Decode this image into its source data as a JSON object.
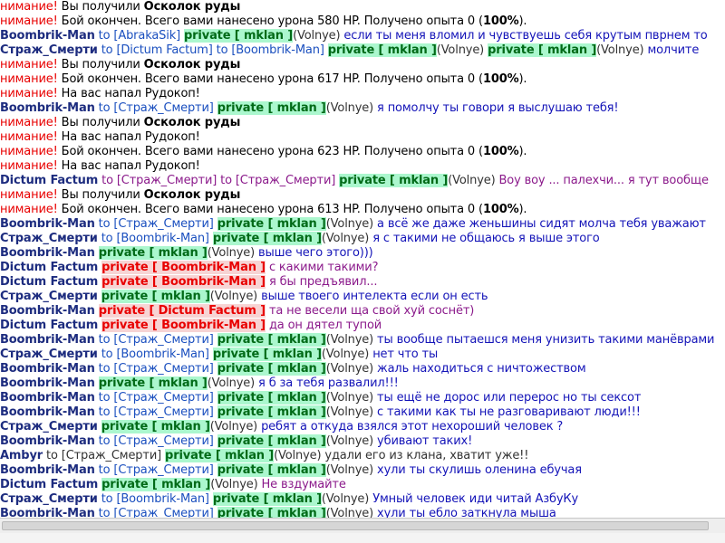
{
  "colors": {
    "attention": "#e80000",
    "system": "#000000",
    "name_dark": "#1d2c7f",
    "name_green": "#008000",
    "private_green_bg": "#abf7ce",
    "private_green_fg": "#006a17",
    "private_red_bg": "#f7d4d4",
    "private_red_fg": "#e80000",
    "to_target": "#1a4fbf"
  },
  "messages": [
    {
      "kind": "sys",
      "parts": [
        {
          "t": "нимание! ",
          "c": "#e80000"
        },
        {
          "t": "Вы получили ",
          "c": "#000000"
        },
        {
          "t": "Осколок руды",
          "c": "#000000",
          "b": true
        }
      ]
    },
    {
      "kind": "sys",
      "parts": [
        {
          "t": "нимание! ",
          "c": "#e80000"
        },
        {
          "t": "Бой окончен. Всего вами нанесено урона 580 HP. Получено опыта 0 (",
          "c": "#000000"
        },
        {
          "t": "100%",
          "c": "#000000",
          "b": true
        },
        {
          "t": ").",
          "c": "#000000"
        }
      ]
    },
    {
      "kind": "chat",
      "parts": [
        {
          "t": "Boombrik-Man",
          "c": "#1d2c7f",
          "b": true
        },
        {
          "t": " to [AbrakaSik] ",
          "c": "#1a4fbf"
        },
        {
          "t": "private [ mklan ]",
          "p": "g"
        },
        {
          "t": "(Volnye) ",
          "c": "#333333"
        },
        {
          "t": "если ты меня вломил и чувствуешь себя крутым пврнем то",
          "c": "#1414b8"
        }
      ]
    },
    {
      "kind": "chat",
      "parts": [
        {
          "t": "Страж_Смерти",
          "c": "#1d2c7f",
          "b": true
        },
        {
          "t": " to [Dictum Factum] to [Boombrik-Man] ",
          "c": "#1a4fbf"
        },
        {
          "t": "private [ mklan ]",
          "p": "g"
        },
        {
          "t": "(Volnye) ",
          "c": "#333333"
        },
        {
          "t": "private [ mklan ]",
          "p": "g"
        },
        {
          "t": "(Volnye) ",
          "c": "#333333"
        },
        {
          "t": "молчите",
          "c": "#1414b8"
        }
      ]
    },
    {
      "kind": "sys",
      "parts": [
        {
          "t": "нимание! ",
          "c": "#e80000"
        },
        {
          "t": "Вы получили ",
          "c": "#000000"
        },
        {
          "t": "Осколок руды",
          "c": "#000000",
          "b": true
        }
      ]
    },
    {
      "kind": "sys",
      "parts": [
        {
          "t": "нимание! ",
          "c": "#e80000"
        },
        {
          "t": "Бой окончен. Всего вами нанесено урона 617 HP. Получено опыта 0 (",
          "c": "#000000"
        },
        {
          "t": "100%",
          "c": "#000000",
          "b": true
        },
        {
          "t": ").",
          "c": "#000000"
        }
      ]
    },
    {
      "kind": "sys",
      "parts": [
        {
          "t": "нимание! ",
          "c": "#e80000"
        },
        {
          "t": "На вас напал Рудокоп!",
          "c": "#000000"
        }
      ]
    },
    {
      "kind": "chat",
      "parts": [
        {
          "t": "Boombrik-Man",
          "c": "#1d2c7f",
          "b": true
        },
        {
          "t": " to [Страж_Смерти] ",
          "c": "#1a4fbf"
        },
        {
          "t": "private [ mklan ]",
          "p": "g"
        },
        {
          "t": "(Volnye) ",
          "c": "#333333"
        },
        {
          "t": "я помолчу ты говори я выслушаю тебя!",
          "c": "#1414b8"
        }
      ]
    },
    {
      "kind": "sys",
      "parts": [
        {
          "t": "нимание! ",
          "c": "#e80000"
        },
        {
          "t": "Вы получили ",
          "c": "#000000"
        },
        {
          "t": "Осколок руды",
          "c": "#000000",
          "b": true
        }
      ]
    },
    {
      "kind": "sys",
      "parts": [
        {
          "t": "нимание! ",
          "c": "#e80000"
        },
        {
          "t": "На вас напал Рудокоп!",
          "c": "#000000"
        }
      ]
    },
    {
      "kind": "sys",
      "parts": [
        {
          "t": "нимание! ",
          "c": "#e80000"
        },
        {
          "t": "Бой окончен. Всего вами нанесено урона 623 HP. Получено опыта 0 (",
          "c": "#000000"
        },
        {
          "t": "100%",
          "c": "#000000",
          "b": true
        },
        {
          "t": ").",
          "c": "#000000"
        }
      ]
    },
    {
      "kind": "sys",
      "parts": [
        {
          "t": "нимание! ",
          "c": "#e80000"
        },
        {
          "t": "На вас напал Рудокоп!",
          "c": "#000000"
        }
      ]
    },
    {
      "kind": "chat",
      "parts": [
        {
          "t": "Dictum Factum",
          "c": "#1d2c7f",
          "b": true
        },
        {
          "t": " to [Страж_Смерти] to [Страж_Смерти] ",
          "c": "#8b1a8b"
        },
        {
          "t": "private [ mklan ]",
          "p": "g"
        },
        {
          "t": "(Volnye) ",
          "c": "#333333"
        },
        {
          "t": "Воу воу ... палехчи... я тут вообще",
          "c": "#8b1a8b"
        }
      ]
    },
    {
      "kind": "sys",
      "parts": [
        {
          "t": "нимание! ",
          "c": "#e80000"
        },
        {
          "t": "Вы получили ",
          "c": "#000000"
        },
        {
          "t": "Осколок руды",
          "c": "#000000",
          "b": true
        }
      ]
    },
    {
      "kind": "sys",
      "parts": [
        {
          "t": "нимание! ",
          "c": "#e80000"
        },
        {
          "t": "Бой окончен. Всего вами нанесено урона 613 HP. Получено опыта 0 (",
          "c": "#000000"
        },
        {
          "t": "100%",
          "c": "#000000",
          "b": true
        },
        {
          "t": ").",
          "c": "#000000"
        }
      ]
    },
    {
      "kind": "chat",
      "parts": [
        {
          "t": "Boombrik-Man",
          "c": "#1d2c7f",
          "b": true
        },
        {
          "t": " to [Страж_Смерти] ",
          "c": "#1a4fbf"
        },
        {
          "t": "private [ mklan ]",
          "p": "g"
        },
        {
          "t": "(Volnye) ",
          "c": "#333333"
        },
        {
          "t": "а всё же даже женьшины сидят молча тебя уважают",
          "c": "#1414b8"
        }
      ]
    },
    {
      "kind": "chat",
      "parts": [
        {
          "t": "Страж_Смерти",
          "c": "#1d2c7f",
          "b": true
        },
        {
          "t": " to [Boombrik-Man] ",
          "c": "#1a4fbf"
        },
        {
          "t": "private [ mklan ]",
          "p": "g"
        },
        {
          "t": "(Volnye) ",
          "c": "#333333"
        },
        {
          "t": "я с такими не общаюсь я выше этого",
          "c": "#1414b8"
        }
      ]
    },
    {
      "kind": "chat",
      "parts": [
        {
          "t": "Boombrik-Man",
          "c": "#1d2c7f",
          "b": true
        },
        {
          "t": " ",
          "c": "#1a4fbf"
        },
        {
          "t": "private [ mklan ]",
          "p": "g"
        },
        {
          "t": "(Volnye) ",
          "c": "#333333"
        },
        {
          "t": "выше чего этого)))",
          "c": "#1414b8"
        }
      ]
    },
    {
      "kind": "chat",
      "parts": [
        {
          "t": "Dictum Factum",
          "c": "#1d2c7f",
          "b": true
        },
        {
          "t": " ",
          "c": "#8b1a8b"
        },
        {
          "t": "private [ Boombrik-Man ]",
          "p": "r"
        },
        {
          "t": " с какими такими?",
          "c": "#8b1a8b"
        }
      ]
    },
    {
      "kind": "chat",
      "parts": [
        {
          "t": "Dictum Factum",
          "c": "#1d2c7f",
          "b": true
        },
        {
          "t": " ",
          "c": "#8b1a8b"
        },
        {
          "t": "private [ Boombrik-Man ]",
          "p": "r"
        },
        {
          "t": " я бы предъявил...",
          "c": "#8b1a8b"
        }
      ]
    },
    {
      "kind": "chat",
      "parts": [
        {
          "t": "Страж_Смерти",
          "c": "#1d2c7f",
          "b": true
        },
        {
          "t": " ",
          "c": "#1a4fbf"
        },
        {
          "t": "private [ mklan ]",
          "p": "g"
        },
        {
          "t": "(Volnye) ",
          "c": "#333333"
        },
        {
          "t": "выше твоего интелекта если он есть",
          "c": "#1414b8"
        }
      ]
    },
    {
      "kind": "chat",
      "parts": [
        {
          "t": "Boombrik-Man",
          "c": "#1d2c7f",
          "b": true
        },
        {
          "t": " ",
          "c": "#8b1a8b"
        },
        {
          "t": "private [ Dictum Factum ]",
          "p": "r"
        },
        {
          "t": " та не весели ща свой хуй соснёт)",
          "c": "#8b1a8b"
        }
      ]
    },
    {
      "kind": "chat",
      "parts": [
        {
          "t": "Dictum Factum",
          "c": "#1d2c7f",
          "b": true
        },
        {
          "t": " ",
          "c": "#8b1a8b"
        },
        {
          "t": "private [ Boombrik-Man ]",
          "p": "r"
        },
        {
          "t": " да он дятел тупой",
          "c": "#8b1a8b"
        }
      ]
    },
    {
      "kind": "chat",
      "parts": [
        {
          "t": "Boombrik-Man",
          "c": "#1d2c7f",
          "b": true
        },
        {
          "t": " to [Страж_Смерти] ",
          "c": "#1a4fbf"
        },
        {
          "t": "private [ mklan ]",
          "p": "g"
        },
        {
          "t": "(Volnye) ",
          "c": "#333333"
        },
        {
          "t": "ты вообще пытаешся меня унизить такими манёврами",
          "c": "#1414b8"
        }
      ]
    },
    {
      "kind": "chat",
      "parts": [
        {
          "t": "Страж_Смерти",
          "c": "#1d2c7f",
          "b": true
        },
        {
          "t": " to [Boombrik-Man] ",
          "c": "#1a4fbf"
        },
        {
          "t": "private [ mklan ]",
          "p": "g"
        },
        {
          "t": "(Volnye) ",
          "c": "#333333"
        },
        {
          "t": "нет что ты",
          "c": "#1414b8"
        }
      ]
    },
    {
      "kind": "chat",
      "parts": [
        {
          "t": "Boombrik-Man",
          "c": "#1d2c7f",
          "b": true
        },
        {
          "t": " to [Страж_Смерти] ",
          "c": "#1a4fbf"
        },
        {
          "t": "private [ mklan ]",
          "p": "g"
        },
        {
          "t": "(Volnye) ",
          "c": "#333333"
        },
        {
          "t": "жаль находиться с ничтожеством",
          "c": "#1414b8"
        }
      ]
    },
    {
      "kind": "chat",
      "parts": [
        {
          "t": "Boombrik-Man",
          "c": "#1d2c7f",
          "b": true
        },
        {
          "t": " ",
          "c": "#1a4fbf"
        },
        {
          "t": "private [ mklan ]",
          "p": "g"
        },
        {
          "t": "(Volnye) ",
          "c": "#333333"
        },
        {
          "t": "я б за тебя развалил!!!",
          "c": "#1414b8"
        }
      ]
    },
    {
      "kind": "chat",
      "parts": [
        {
          "t": "Boombrik-Man",
          "c": "#1d2c7f",
          "b": true
        },
        {
          "t": " to [Страж_Смерти] ",
          "c": "#1a4fbf"
        },
        {
          "t": "private [ mklan ]",
          "p": "g"
        },
        {
          "t": "(Volnye) ",
          "c": "#333333"
        },
        {
          "t": "ты ещё не дорос или перерос но ты сексот",
          "c": "#1414b8"
        }
      ]
    },
    {
      "kind": "chat",
      "parts": [
        {
          "t": "Boombrik-Man",
          "c": "#1d2c7f",
          "b": true
        },
        {
          "t": " to [Страж_Смерти] ",
          "c": "#1a4fbf"
        },
        {
          "t": "private [ mklan ]",
          "p": "g"
        },
        {
          "t": "(Volnye) ",
          "c": "#333333"
        },
        {
          "t": "с такими как ты не разговаривают люди!!!",
          "c": "#1414b8"
        }
      ]
    },
    {
      "kind": "chat",
      "parts": [
        {
          "t": "Страж_Смерти",
          "c": "#1d2c7f",
          "b": true
        },
        {
          "t": " ",
          "c": "#1a4fbf"
        },
        {
          "t": "private [ mklan ]",
          "p": "g"
        },
        {
          "t": "(Volnye) ",
          "c": "#333333"
        },
        {
          "t": "ребят а откуда взялся этот нехороший человек ?",
          "c": "#1414b8"
        }
      ]
    },
    {
      "kind": "chat",
      "parts": [
        {
          "t": "Boombrik-Man",
          "c": "#1d2c7f",
          "b": true
        },
        {
          "t": " to [Страж_Смерти] ",
          "c": "#1a4fbf"
        },
        {
          "t": "private [ mklan ]",
          "p": "g"
        },
        {
          "t": "(Volnye) ",
          "c": "#333333"
        },
        {
          "t": "убивают таких!",
          "c": "#1414b8"
        }
      ]
    },
    {
      "kind": "chat",
      "parts": [
        {
          "t": "Ambyr",
          "c": "#1d2c7f",
          "b": true
        },
        {
          "t": " to [Страж_Смерти] ",
          "c": "#333333"
        },
        {
          "t": "private [ mklan ]",
          "p": "g"
        },
        {
          "t": "(Volnye) ",
          "c": "#333333"
        },
        {
          "t": "удали его из клана, хватит уже!!",
          "c": "#333333"
        }
      ]
    },
    {
      "kind": "chat",
      "parts": [
        {
          "t": "Boombrik-Man",
          "c": "#1d2c7f",
          "b": true
        },
        {
          "t": " to [Страж_Смерти] ",
          "c": "#1a4fbf"
        },
        {
          "t": "private [ mklan ]",
          "p": "g"
        },
        {
          "t": "(Volnye) ",
          "c": "#333333"
        },
        {
          "t": "хули ты скулишь оленина ебучая",
          "c": "#1414b8"
        }
      ]
    },
    {
      "kind": "chat",
      "parts": [
        {
          "t": "Dictum Factum",
          "c": "#1d2c7f",
          "b": true
        },
        {
          "t": " ",
          "c": "#8b1a8b"
        },
        {
          "t": "private [ mklan ]",
          "p": "g"
        },
        {
          "t": "(Volnye) ",
          "c": "#333333"
        },
        {
          "t": "Не вздумайте",
          "c": "#8b1a8b"
        }
      ]
    },
    {
      "kind": "chat",
      "parts": [
        {
          "t": "Страж_Смерти",
          "c": "#1d2c7f",
          "b": true
        },
        {
          "t": " to [Boombrik-Man] ",
          "c": "#1a4fbf"
        },
        {
          "t": "private [ mklan ]",
          "p": "g"
        },
        {
          "t": "(Volnye) ",
          "c": "#333333"
        },
        {
          "t": "Умный человек иди читай АзбуКу",
          "c": "#1414b8"
        }
      ]
    },
    {
      "kind": "chat",
      "parts": [
        {
          "t": "Boombrik-Man",
          "c": "#1d2c7f",
          "b": true
        },
        {
          "t": " to [Страж_Смерти] ",
          "c": "#1a4fbf"
        },
        {
          "t": "private [ mklan ]",
          "p": "g"
        },
        {
          "t": "(Volnye) ",
          "c": "#333333"
        },
        {
          "t": "хули ты ебло заткнула мыша",
          "c": "#1414b8"
        }
      ]
    }
  ]
}
